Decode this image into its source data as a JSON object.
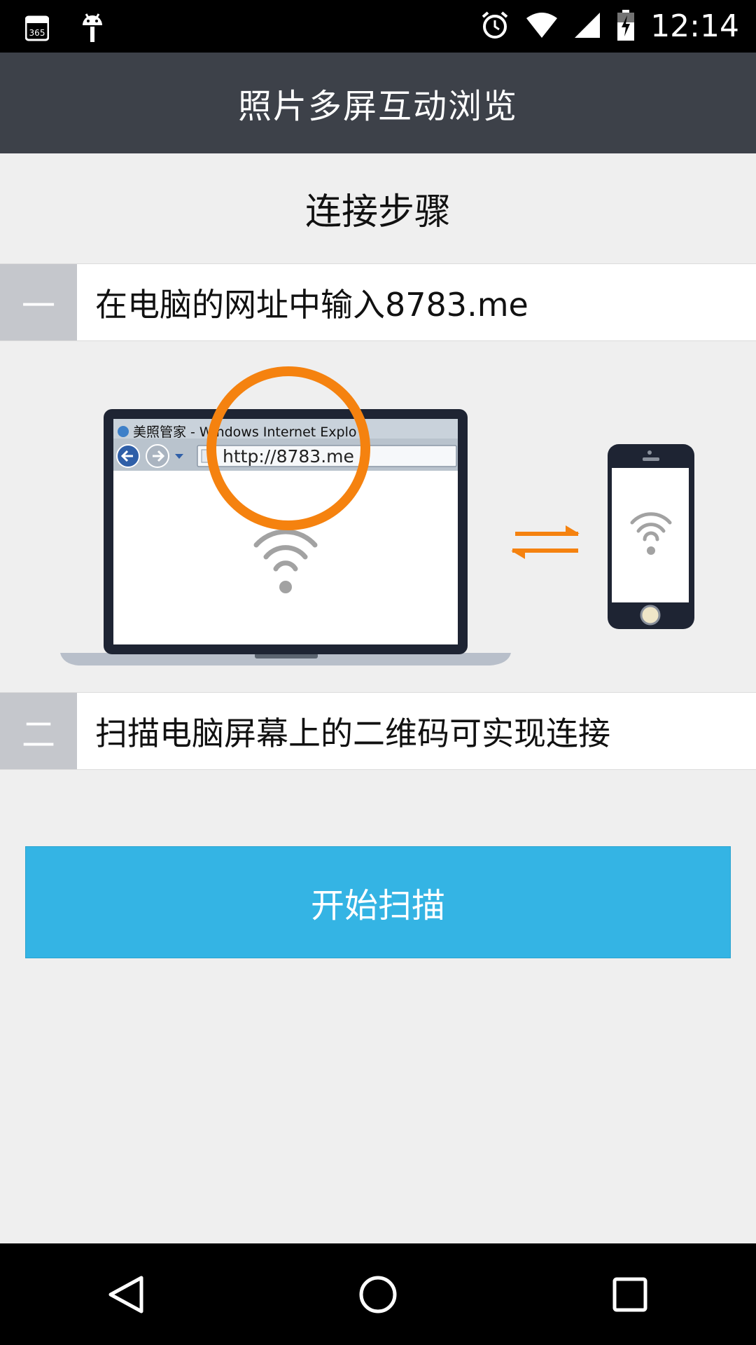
{
  "status_bar": {
    "time": "12:14",
    "calendar_badge": "365",
    "icons": [
      "calendar-365-icon",
      "android-debug-icon",
      "alarm-icon",
      "wifi-icon",
      "cell-signal-icon",
      "battery-charging-icon"
    ]
  },
  "app_bar": {
    "title": "照片多屏互动浏览"
  },
  "section": {
    "title": "连接步骤"
  },
  "steps": [
    {
      "number": "一",
      "text": "在电脑的网址中输入8783.me"
    },
    {
      "number": "二",
      "text": "扫描电脑屏幕上的二维码可实现连接"
    }
  ],
  "illustration": {
    "browser_tab_title": "美照管家 - Windows Internet Explo",
    "address_url": "http://8783.me",
    "highlight_color": "#f5820f",
    "icons": [
      "laptop-illustration",
      "wifi-illustration-icon",
      "sync-arrows-icon",
      "phone-illustration"
    ]
  },
  "actions": {
    "scan_label": "开始扫描"
  },
  "colors": {
    "app_bar_bg": "#3d4149",
    "button_bg": "#34b4e4",
    "step_num_bg": "#c5c7cc",
    "page_bg": "#efefef"
  },
  "nav_bar": {
    "icons": [
      "back-icon",
      "home-icon",
      "recents-icon"
    ]
  }
}
